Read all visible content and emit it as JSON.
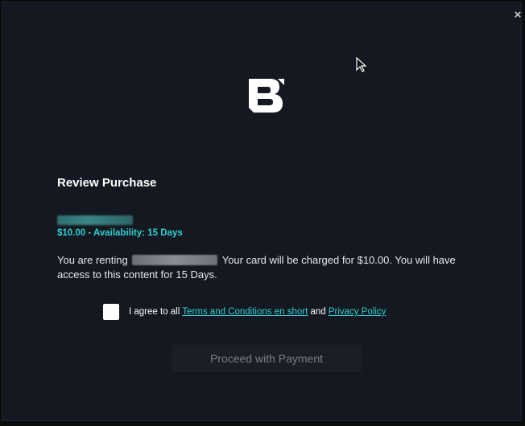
{
  "dialog": {
    "close_glyph": "×",
    "title": "Review Purchase",
    "price_line": "$10.00 - Availability: 15 Days",
    "description": {
      "prefix": "You are renting",
      "suffix": "Your card will be charged for $10.00. You will have access to this content for 15 Days."
    },
    "agreement": {
      "prefix": "I agree to all",
      "terms_link": "Terms and Conditions en short",
      "connector": "and",
      "privacy_link": "Privacy Policy"
    },
    "proceed_label": "Proceed with Payment"
  },
  "colors": {
    "accent": "#2ed0d2",
    "background": "#141820",
    "disabled_button": "#1a1e26"
  }
}
